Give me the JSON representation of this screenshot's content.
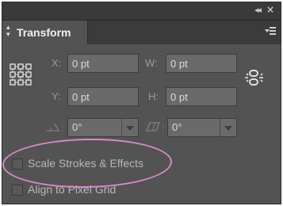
{
  "panel": {
    "title": "Transform",
    "collapse_glyph": "◂◂",
    "close_glyph": "×",
    "menu_icon": "panel-menu-icon",
    "accent_colors": {
      "panel_bg": "#535353",
      "field_bg": "#6a6a6a",
      "highlight_ellipse": "#d58bc8"
    }
  },
  "fields": {
    "x": {
      "label": "X:",
      "value": "0 pt"
    },
    "y": {
      "label": "Y:",
      "value": "0 pt"
    },
    "w": {
      "label": "W:",
      "value": "0 pt"
    },
    "h": {
      "label": "H:",
      "value": "0 pt"
    },
    "rotate": {
      "value": "0°",
      "icon": "rotate-angle-icon"
    },
    "shear": {
      "value": "0°",
      "icon": "shear-angle-icon"
    }
  },
  "options": {
    "scale_strokes": {
      "label": "Scale Strokes & Effects",
      "checked": false
    },
    "align_pixel": {
      "label": "Align to Pixel Grid",
      "checked": false
    }
  }
}
